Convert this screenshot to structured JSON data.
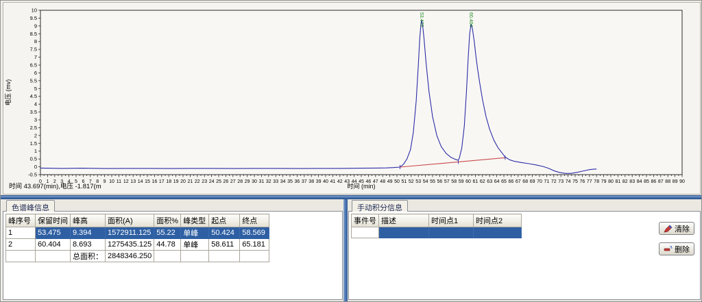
{
  "colors": {
    "trace_blue": "#2B2BA6",
    "baseline_red": "#C94A4A",
    "peak_label_green": "#1E8A1E",
    "selection_blue": "#2E5FA3",
    "splitter_blue": "#4A74AF"
  },
  "chart": {
    "status_text": "时间 43.697(min),电压 -1.817(m"
  },
  "chart_data": {
    "type": "line",
    "title": "",
    "xlabel": "时间 (min)",
    "ylabel": "电压 (mv)",
    "xlim": [
      0,
      90
    ],
    "ylim": [
      -0.5,
      10
    ],
    "x_tick_step": 1,
    "x_minor_tick_step": 0.5,
    "y_tick_step": 0.5,
    "grid": false,
    "series": [
      {
        "name": "signal",
        "color": "#2B2BA6",
        "points": [
          [
            0,
            -0.08
          ],
          [
            3,
            -0.1
          ],
          [
            6,
            -0.09
          ],
          [
            9,
            -0.11
          ],
          [
            12,
            -0.1
          ],
          [
            15,
            -0.1
          ],
          [
            18,
            -0.11
          ],
          [
            21,
            -0.1
          ],
          [
            24,
            -0.1
          ],
          [
            27,
            -0.11
          ],
          [
            30,
            -0.1
          ],
          [
            33,
            -0.1
          ],
          [
            36,
            -0.11
          ],
          [
            39,
            -0.1
          ],
          [
            42,
            -0.1
          ],
          [
            45,
            -0.09
          ],
          [
            47,
            -0.08
          ],
          [
            48.5,
            -0.07
          ],
          [
            49.5,
            -0.05
          ],
          [
            50.424,
            -0.02
          ],
          [
            50.9,
            0.15
          ],
          [
            51.4,
            0.5
          ],
          [
            51.9,
            1.1
          ],
          [
            52.3,
            2.2
          ],
          [
            52.7,
            4.2
          ],
          [
            53.0,
            6.5
          ],
          [
            53.2,
            8.2
          ],
          [
            53.35,
            9.0
          ],
          [
            53.475,
            9.35
          ],
          [
            53.62,
            9.0
          ],
          [
            53.8,
            8.2
          ],
          [
            54.1,
            6.6
          ],
          [
            54.5,
            4.8
          ],
          [
            55.0,
            3.2
          ],
          [
            55.6,
            2.0
          ],
          [
            56.2,
            1.3
          ],
          [
            56.9,
            0.85
          ],
          [
            57.6,
            0.6
          ],
          [
            58.2,
            0.47
          ],
          [
            58.59,
            0.42
          ],
          [
            58.75,
            0.55
          ],
          [
            59.1,
            1.2
          ],
          [
            59.45,
            2.6
          ],
          [
            59.75,
            4.8
          ],
          [
            60.0,
            7.0
          ],
          [
            60.2,
            8.5
          ],
          [
            60.404,
            9.12
          ],
          [
            60.6,
            8.8
          ],
          [
            60.85,
            8.0
          ],
          [
            61.1,
            7.0
          ],
          [
            61.3,
            6.3
          ],
          [
            61.6,
            5.4
          ],
          [
            62.0,
            4.3
          ],
          [
            62.5,
            3.2
          ],
          [
            63.0,
            2.4
          ],
          [
            63.6,
            1.7
          ],
          [
            64.2,
            1.2
          ],
          [
            64.8,
            0.85
          ],
          [
            65.181,
            0.62
          ],
          [
            65.8,
            0.45
          ],
          [
            66.5,
            0.35
          ],
          [
            67.5,
            0.27
          ],
          [
            68.5,
            0.2
          ],
          [
            69.5,
            0.12
          ],
          [
            70.5,
            0.02
          ],
          [
            71.3,
            -0.1
          ],
          [
            72.0,
            -0.25
          ],
          [
            72.8,
            -0.36
          ],
          [
            73.6,
            -0.42
          ],
          [
            74.4,
            -0.42
          ],
          [
            75.2,
            -0.36
          ],
          [
            76.0,
            -0.28
          ],
          [
            76.8,
            -0.2
          ],
          [
            77.4,
            -0.16
          ],
          [
            78.0,
            -0.14
          ]
        ]
      },
      {
        "name": "integration-baseline",
        "color": "#C94A4A",
        "points": [
          [
            50.424,
            -0.02
          ],
          [
            65.181,
            0.58
          ]
        ],
        "tick_marks_x": [
          50.424,
          58.6,
          65.181
        ]
      }
    ],
    "peak_labels": [
      {
        "x": 53.475,
        "label": "53.475"
      },
      {
        "x": 60.404,
        "label": "60.404"
      }
    ]
  },
  "left_panel": {
    "tab": "色谱峰信息",
    "columns": [
      "峰序号",
      "保留时间",
      "峰高",
      "面积(A)",
      "面积%",
      "峰类型",
      "起点",
      "终点"
    ],
    "rows": [
      {
        "cells": [
          "1",
          "53.475",
          "9.394",
          "1572911.125",
          "55.22",
          "单峰",
          "50.424",
          "58.569"
        ],
        "selected": true
      },
      {
        "cells": [
          "2",
          "60.404",
          "8.693",
          "1275435.125",
          "44.78",
          "单峰",
          "58.611",
          "65.181"
        ],
        "selected": false
      },
      {
        "cells": [
          "",
          "",
          "总面积：",
          "2848346.250",
          "",
          "",
          "",
          ""
        ],
        "selected": false
      }
    ]
  },
  "right_panel": {
    "tab": "手动积分信息",
    "columns": [
      "事件号",
      "描述",
      "时间点1",
      "时间点2"
    ],
    "rows": [
      {
        "cells": [
          "",
          "",
          "",
          ""
        ],
        "selected": true
      }
    ],
    "buttons": {
      "clear": "清除",
      "delete": "删除"
    }
  }
}
